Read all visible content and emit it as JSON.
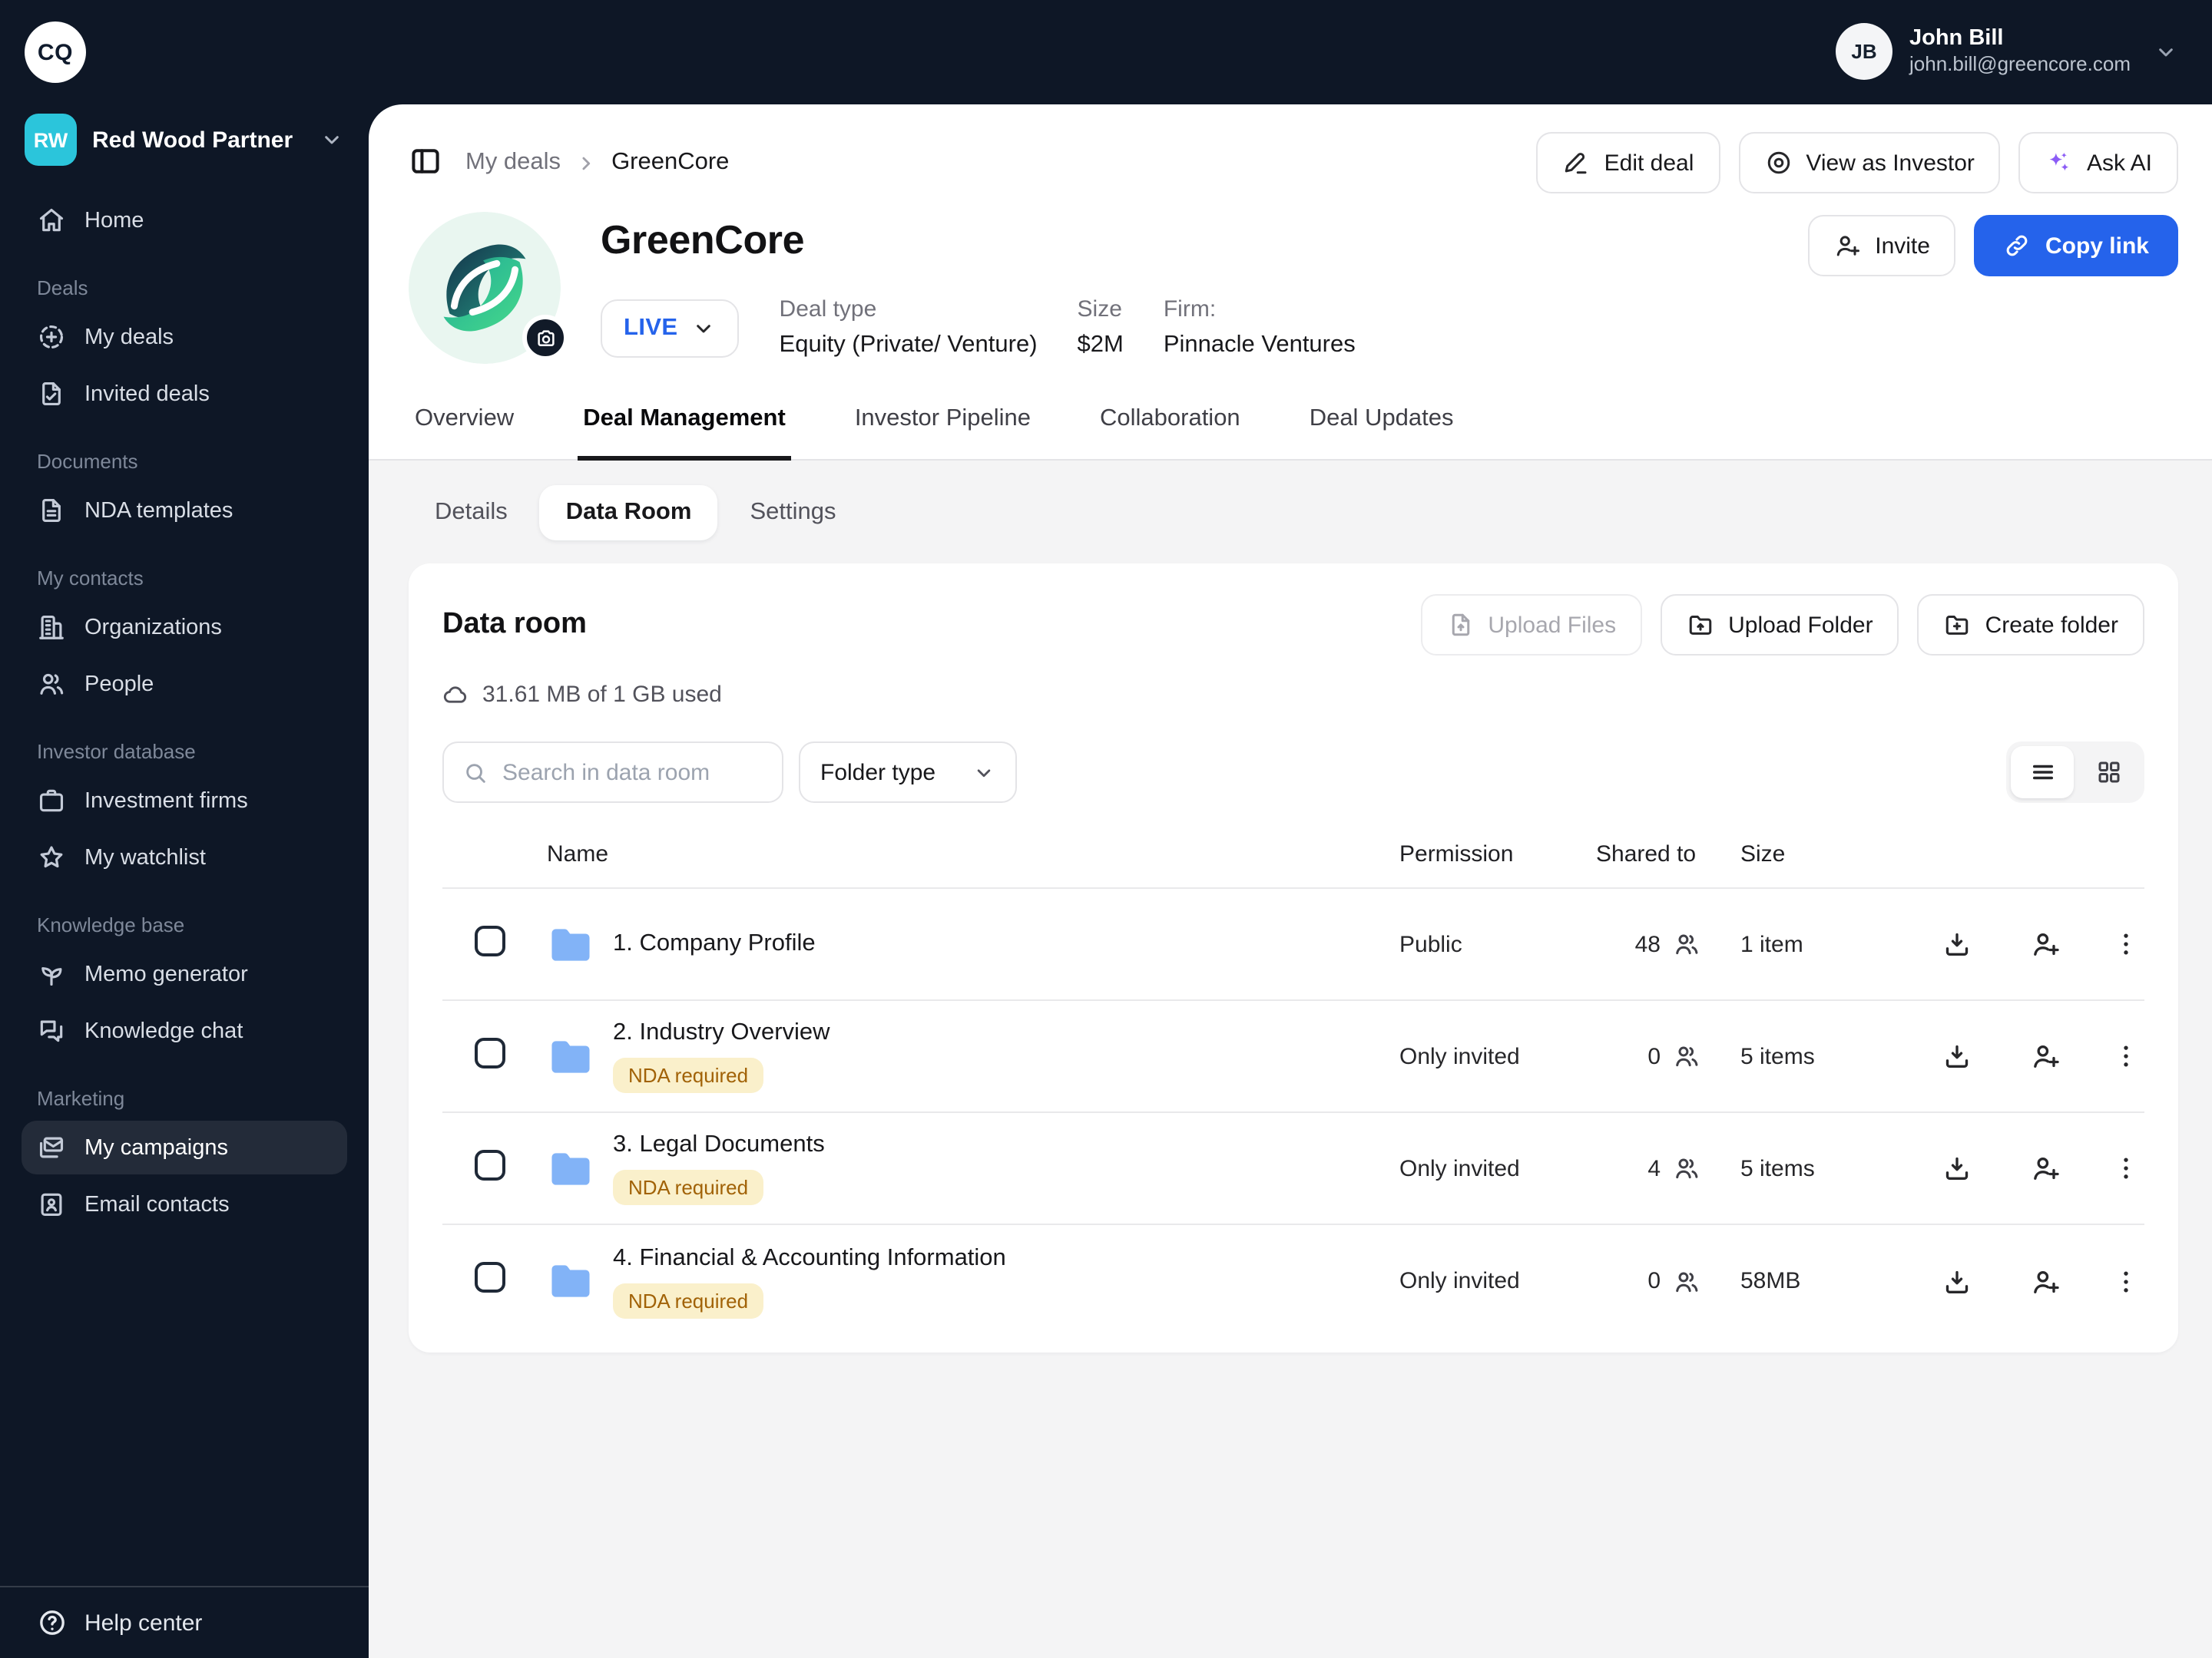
{
  "brand": {
    "logo": "CQ"
  },
  "workspace": {
    "initials": "RW",
    "name": "Red Wood Partner"
  },
  "user": {
    "initials": "JB",
    "name": "John Bill",
    "email": "john.bill@greencore.com"
  },
  "sidebar": {
    "home_label": "Home",
    "sections": [
      {
        "label": "Deals",
        "items": [
          {
            "label": "My deals",
            "icon": "deals"
          },
          {
            "label": "Invited deals",
            "icon": "invited"
          }
        ]
      },
      {
        "label": "Documents",
        "items": [
          {
            "label": "NDA templates",
            "icon": "file-text"
          }
        ]
      },
      {
        "label": "My contacts",
        "items": [
          {
            "label": "Organizations",
            "icon": "building"
          },
          {
            "label": "People",
            "icon": "users"
          }
        ]
      },
      {
        "label": "Investor database",
        "items": [
          {
            "label": "Investment firms",
            "icon": "briefcase"
          },
          {
            "label": "My watchlist",
            "icon": "star"
          }
        ]
      },
      {
        "label": "Knowledge base",
        "items": [
          {
            "label": "Memo generator",
            "icon": "sprout"
          },
          {
            "label": "Knowledge chat",
            "icon": "chat"
          }
        ]
      },
      {
        "label": "Marketing",
        "items": [
          {
            "label": "My campaigns",
            "icon": "mails",
            "active": true
          },
          {
            "label": "Email contacts",
            "icon": "contact"
          }
        ]
      }
    ],
    "help_label": "Help center"
  },
  "topbar": {
    "breadcrumb": {
      "parent": "My deals",
      "current": "GreenCore"
    },
    "actions": {
      "edit": "Edit deal",
      "view_as_investor": "View as Investor",
      "ask_ai": "Ask AI"
    }
  },
  "deal": {
    "name": "GreenCore",
    "status": "LIVE",
    "meta": [
      {
        "label": "Deal type",
        "value": "Equity (Private/ Venture)"
      },
      {
        "label": "Size",
        "value": "$2M"
      },
      {
        "label": "Firm:",
        "value": "Pinnacle Ventures"
      }
    ],
    "invite": "Invite",
    "copy_link": "Copy link"
  },
  "tabs": {
    "active": "Deal Management",
    "items": [
      "Overview",
      "Deal Management",
      "Investor Pipeline",
      "Collaboration",
      "Deal Updates"
    ]
  },
  "subtabs": {
    "active": "Data Room",
    "items": [
      "Details",
      "Data Room",
      "Settings"
    ]
  },
  "data_room": {
    "title": "Data room",
    "storage_used": "31.61 MB of 1 GB used",
    "actions": {
      "upload_files": "Upload Files",
      "upload_folder": "Upload Folder",
      "create_folder": "Create folder"
    },
    "search_placeholder": "Search in data room",
    "filter_label": "Folder type",
    "table": {
      "headers": [
        "Name",
        "Permission",
        "Shared to",
        "Size"
      ],
      "rows": [
        {
          "name": "1. Company Profile",
          "permission": "Public",
          "shared_to": "48",
          "size": "1 item"
        },
        {
          "name": "2. Industry Overview",
          "nda_label": "NDA required",
          "permission": "Only invited",
          "shared_to": "0",
          "size": "5 items"
        },
        {
          "name": "3. Legal Documents",
          "nda_label": "NDA required",
          "permission": "Only invited",
          "shared_to": "4",
          "size": "5 items"
        },
        {
          "name": "4. Financial & Accounting Information",
          "nda_label": "NDA required",
          "permission": "Only invited",
          "shared_to": "0",
          "size": "58MB"
        }
      ]
    }
  },
  "colors": {
    "sidebar_bg": "#0E1726",
    "accent_blue": "#2563EB",
    "live_blue": "#2563EB",
    "workspace_teal": "#2BC5DB",
    "sparkle_purple": "#8B5CF6",
    "folder_blue": "#82B3F7",
    "nda_bg": "#FAF0CB",
    "nda_text": "#A16207",
    "content_bg": "#F4F4F5"
  }
}
